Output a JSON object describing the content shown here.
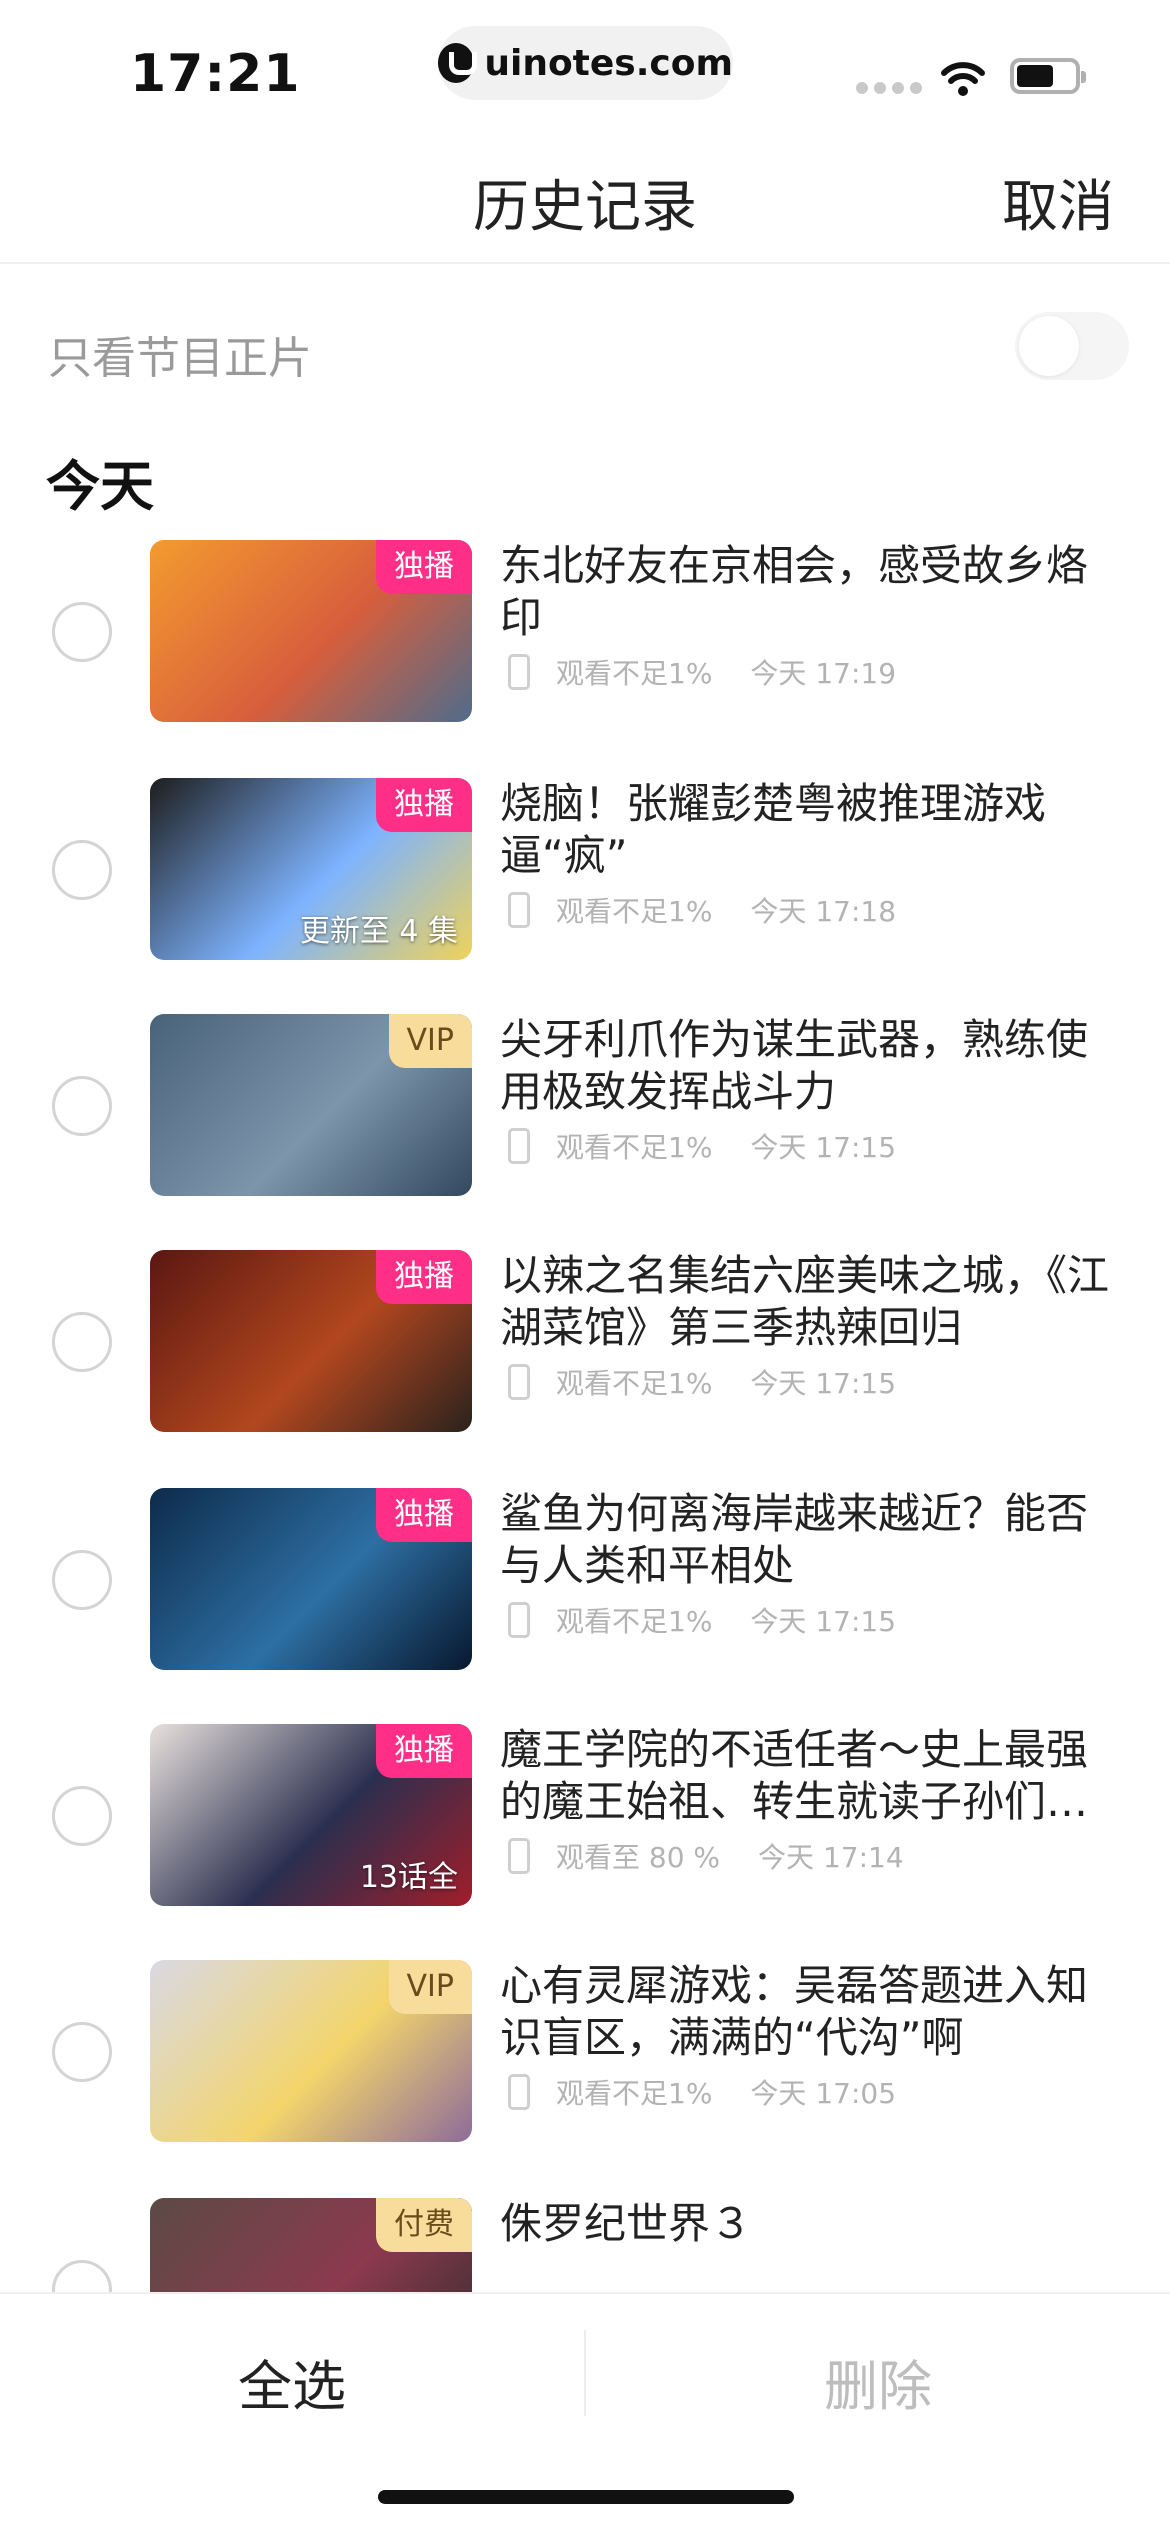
{
  "status_bar": {
    "time": "17:21",
    "url": "uinotes.com"
  },
  "header": {
    "title": "历史记录",
    "cancel_label": "取消"
  },
  "filter": {
    "label": "只看节目正片",
    "toggle_on": false
  },
  "section": {
    "title": "今天"
  },
  "items": [
    {
      "title": "东北好友在京相会，感受故乡烙印",
      "badge": "独播",
      "badge_type": "exclusive",
      "caption": "",
      "progress": "观看不足1%",
      "time": "今天 17:19",
      "thumb_colors": [
        "#f39b2f",
        "#d85e3c",
        "#4f6c8c"
      ]
    },
    {
      "title": "烧脑！张耀彭楚粤被推理游戏逼“疯”",
      "badge": "独播",
      "badge_type": "exclusive",
      "caption": "更新至 4 集",
      "progress": "观看不足1%",
      "time": "今天 17:18",
      "thumb_colors": [
        "#1d1d1d",
        "#7db3ff",
        "#f0d25a"
      ]
    },
    {
      "title": "尖牙利爪作为谋生武器，熟练使用极致发挥战斗力",
      "badge": "VIP",
      "badge_type": "vip",
      "caption": "",
      "progress": "观看不足1%",
      "time": "今天 17:15",
      "thumb_colors": [
        "#48627a",
        "#7d95ab",
        "#32495e"
      ]
    },
    {
      "title": "以辣之名集结六座美味之城，《江湖菜馆》第三季热辣回归",
      "badge": "独播",
      "badge_type": "exclusive",
      "caption": "",
      "progress": "观看不足1%",
      "time": "今天 17:15",
      "thumb_colors": [
        "#5b1712",
        "#b2471e",
        "#2a221d"
      ]
    },
    {
      "title": "鲨鱼为何离海岸越来越近？能否与人类和平相处",
      "badge": "独播",
      "badge_type": "exclusive",
      "caption": "",
      "progress": "观看不足1%",
      "time": "今天 17:15",
      "thumb_colors": [
        "#0d2b4b",
        "#2d6fa3",
        "#08182f"
      ]
    },
    {
      "title": "魔王学院的不适任者～史上最强的魔王始祖、转生就读子孙们…",
      "badge": "独播",
      "badge_type": "exclusive",
      "caption": "13话全",
      "progress": "观看至 80 %",
      "time": "今天 17:14",
      "thumb_colors": [
        "#e8e1dd",
        "#2b2f4f",
        "#a11d2a"
      ]
    },
    {
      "title": "心有灵犀游戏：吴磊答题进入知识盲区，满满的“代沟”啊",
      "badge": "VIP",
      "badge_type": "vip",
      "caption": "",
      "progress": "观看不足1%",
      "time": "今天 17:05",
      "thumb_colors": [
        "#d9d9e4",
        "#f3d56c",
        "#8d6b9a"
      ]
    },
    {
      "title": "侏罗纪世界３",
      "badge": "付费",
      "badge_type": "paid",
      "caption": "",
      "progress": "",
      "time": "",
      "thumb_colors": [
        "#5b4a45",
        "#8c3a4e",
        "#2f2a2d"
      ]
    }
  ],
  "bottom_bar": {
    "select_all_label": "全选",
    "delete_label": "删除"
  }
}
